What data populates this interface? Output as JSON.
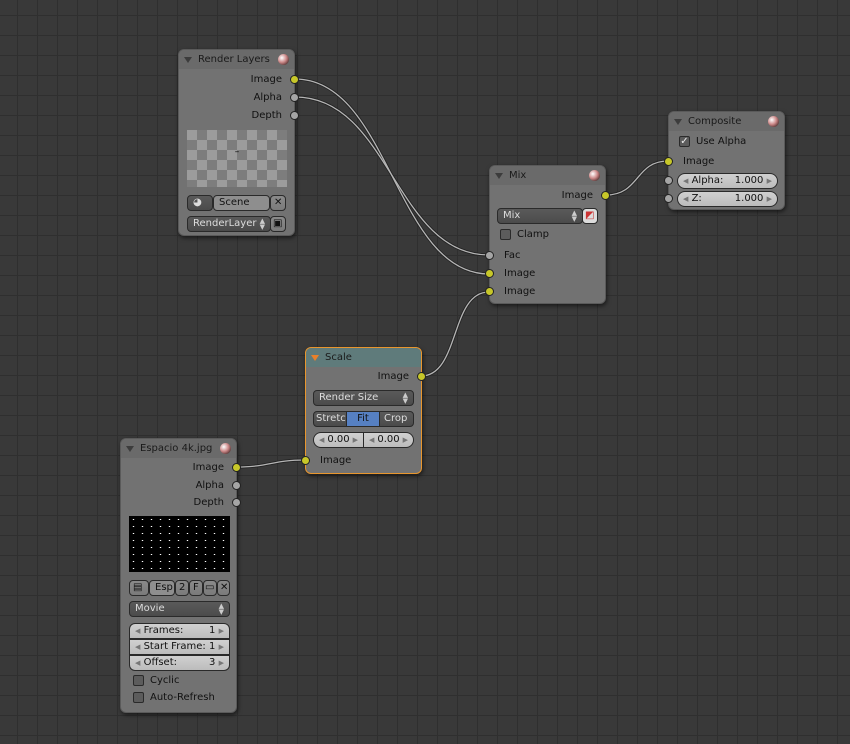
{
  "render_layers": {
    "title": "Render Layers",
    "outputs": [
      "Image",
      "Alpha",
      "Depth"
    ],
    "preview_mark": "–",
    "scene": "Scene",
    "layer": "RenderLayer"
  },
  "image_node": {
    "title": "Espacio 4k.jpg",
    "outputs": [
      "Image",
      "Alpha",
      "Depth"
    ],
    "tabs": [
      "Esp",
      "2",
      "F"
    ],
    "source": "Movie",
    "frames_label": "Frames:",
    "frames": "1",
    "start_label": "Start Frame:",
    "start": "1",
    "offset_label": "Offset:",
    "offset": "3",
    "cyclic": "Cyclic",
    "auto_refresh": "Auto-Refresh"
  },
  "scale": {
    "title": "Scale",
    "output": "Image",
    "space": "Render Size",
    "modes": [
      "Stretc",
      "Fit",
      "Crop"
    ],
    "active_mode": "Fit",
    "x": "0.00",
    "y": "0.00",
    "input": "Image"
  },
  "mix": {
    "title": "Mix",
    "output": "Image",
    "blend": "Mix",
    "clamp": "Clamp",
    "inputs": [
      "Fac",
      "Image",
      "Image"
    ]
  },
  "composite": {
    "title": "Composite",
    "use_alpha": "Use Alpha",
    "use_alpha_checked": true,
    "input": "Image",
    "alpha_label": "Alpha:",
    "alpha": "1.000",
    "z_label": "Z:",
    "z": "1.000"
  },
  "colors": {
    "image_socket": "#c7c729",
    "value_socket": "#a5a5a5",
    "selected_border": "#e8962e",
    "active_button": "#5680c2"
  }
}
